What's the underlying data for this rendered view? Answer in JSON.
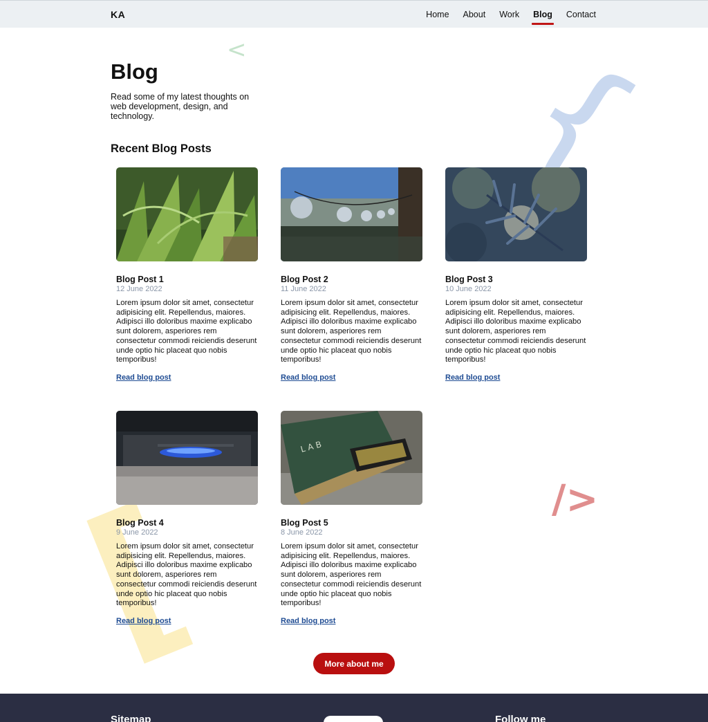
{
  "nav": {
    "logo": "KA",
    "items": [
      {
        "label": "Home",
        "active": false
      },
      {
        "label": "About",
        "active": false
      },
      {
        "label": "Work",
        "active": false
      },
      {
        "label": "Blog",
        "active": true
      },
      {
        "label": "Contact",
        "active": false
      }
    ]
  },
  "page": {
    "title": "Blog",
    "intro": "Read some of my latest thoughts on web development, design, and technology."
  },
  "section": {
    "title": "Recent Blog Posts"
  },
  "posts": [
    {
      "title": "Blog Post 1",
      "date": "12 June 2022",
      "excerpt": "Lorem ipsum dolor sit amet, consectetur adipisicing elit. Repellendus, maiores. Adipisci illo doloribus maxime explicabo sunt dolorem, asperiores rem consectetur commodi reiciendis deserunt unde optio hic placeat quo nobis temporibus!",
      "link": "Read blog post"
    },
    {
      "title": "Blog Post 2",
      "date": "11 June 2022",
      "excerpt": "Lorem ipsum dolor sit amet, consectetur adipisicing elit. Repellendus, maiores. Adipisci illo doloribus maxime explicabo sunt dolorem, asperiores rem consectetur commodi reiciendis deserunt unde optio hic placeat quo nobis temporibus!",
      "link": "Read blog post"
    },
    {
      "title": "Blog Post 3",
      "date": "10 June 2022",
      "excerpt": "Lorem ipsum dolor sit amet, consectetur adipisicing elit. Repellendus, maiores. Adipisci illo doloribus maxime explicabo sunt dolorem, asperiores rem consectetur commodi reiciendis deserunt unde optio hic placeat quo nobis temporibus!",
      "link": "Read blog post"
    },
    {
      "title": "Blog Post 4",
      "date": "9 June 2022",
      "excerpt": "Lorem ipsum dolor sit amet, consectetur adipisicing elit. Repellendus, maiores. Adipisci illo doloribus maxime explicabo sunt dolorem, asperiores rem consectetur commodi reiciendis deserunt unde optio hic placeat quo nobis temporibus!",
      "link": "Read blog post"
    },
    {
      "title": "Blog Post 5",
      "date": "8 June 2022",
      "excerpt": "Lorem ipsum dolor sit amet, consectetur adipisicing elit. Repellendus, maiores. Adipisci illo doloribus maxime explicabo sunt dolorem, asperiores rem consectetur commodi reiciendis deserunt unde optio hic placeat quo nobis temporibus!",
      "link": "Read blog post"
    }
  ],
  "cta": {
    "label": "More about me"
  },
  "footer": {
    "sitemap": "Sitemap",
    "follow": "Follow me"
  },
  "decorations": {
    "left_angle": "<",
    "curly_brace": "{",
    "square_bracket": "[",
    "close_tag": "/>"
  },
  "colors": {
    "accent": "#b90f0f",
    "link": "#1f4c93",
    "footer_bg": "#2b2e43",
    "nav_bg": "#ecf0f3",
    "date": "#8a96a8"
  }
}
